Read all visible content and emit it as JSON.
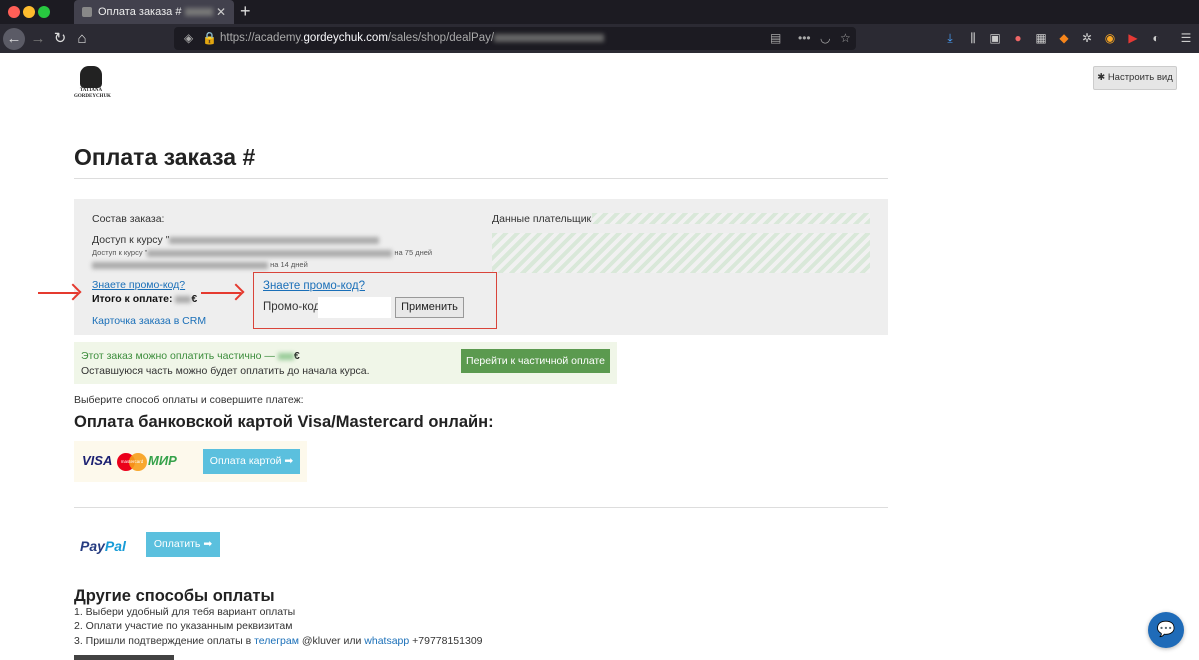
{
  "browser": {
    "tab_title": "Оплата заказа #",
    "url_prefix": "https://academy.",
    "url_domain": "gordeychuk.com",
    "url_path": "/sales/shop/dealPay/"
  },
  "logo": {
    "line1": "TATIANA",
    "line2": "GORDEYCHUK"
  },
  "customize_button": "Настроить вид",
  "page_title": "Оплата заказа #",
  "summary": {
    "order_label": "Состав заказа:",
    "course_prefix": "Доступ к курсу \"",
    "sub_prefix": "Доступ к курсу \"",
    "sub_mid": "на 75 дней",
    "sub_suffix": "на 14 дней",
    "promo_link": "Знаете промо-код?",
    "total_label": "Итого к оплате:",
    "total_currency": "€",
    "crm_link": "Карточка заказа в CRM",
    "payer_label": "Данные плательщика:"
  },
  "promo": {
    "link": "Знаете промо-код?",
    "label": "Промо-код",
    "input_value": "",
    "apply_button": "Применить"
  },
  "partial": {
    "line1_prefix": "Этот заказ можно оплатить частично —",
    "line1_currency": "€",
    "line2": "Оставшуюся часть можно будет оплатить до начала курса.",
    "button": "Перейти к частичной оплате"
  },
  "choose_text": "Выберите способ оплаты и совершите платеж:",
  "card_section": {
    "heading": "Оплата банковской картой Visa/Mastercard онлайн:",
    "visa": "VISA",
    "mastercard": "mastercard",
    "mir": "МИР",
    "button": "Оплата картой ➡"
  },
  "paypal": {
    "logo_a": "Pay",
    "logo_b": "Pal",
    "button": "Оплатить ➡"
  },
  "other": {
    "heading": "Другие способы оплаты",
    "step1": "1. Выбери удобный для тебя вариант оплаты",
    "step2": "2. Оплати участие по указанным реквизитам",
    "step3_prefix": "3. Пришли подтверждение оплаты в",
    "telegram": "телеграм",
    "telegram_handle": "@kluver или",
    "whatsapp": "whatsapp",
    "phone": "+79778151309"
  },
  "colors": {
    "accent_green": "#5b9a4f",
    "link_blue": "#1a6fb8",
    "highlight_red": "#d9443a",
    "pay_button": "#5bc0de"
  }
}
